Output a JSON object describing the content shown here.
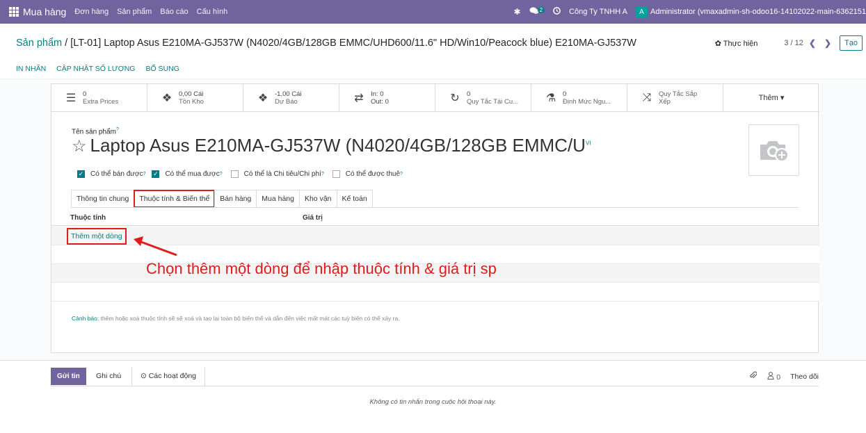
{
  "topbar": {
    "brand": "Mua hàng",
    "menu": [
      "Đơn hàng",
      "Sản phẩm",
      "Báo cáo",
      "Cấu hình"
    ],
    "messages_badge": "2",
    "company": "Công Ty TNHH A",
    "avatar_letter": "A",
    "user": "Administrator (vmaxadmin-sh-odoo16-14102022-main-6362151"
  },
  "breadcrumb": {
    "parent": "Sản phẩm",
    "separator": " / ",
    "current": "[LT-01] Laptop Asus E210MA-GJ537W (N4020/4GB/128GB EMMC/UHD600/11.6\" HD/Win10/Peacock blue) E210MA-GJ537W"
  },
  "pager": {
    "action_label": "✿ Thực hiện",
    "counter": "3 / 12",
    "prev": "❮",
    "next": "❯",
    "create_label": "Tạo"
  },
  "actions": [
    "IN NHÃN",
    "CẬP NHẬT SỐ LƯỢNG",
    "BỔ SUNG"
  ],
  "smart_buttons": [
    {
      "icon": "☰",
      "value": "0",
      "label": "Extra Prices"
    },
    {
      "icon": "❖",
      "value": "0,00 Cái",
      "label": "Tồn Kho"
    },
    {
      "icon": "❖",
      "value": "-1,00 Cái",
      "label": "Dự Báo"
    },
    {
      "icon": "⇄",
      "value": "In:  0",
      "label": "Out:  0"
    },
    {
      "icon": "↻",
      "value": "0",
      "label": "Quy Tắc Tái Cu..."
    },
    {
      "icon": "⚗",
      "value": "0",
      "label": "Định Mức Ngu..."
    },
    {
      "icon": "⤨",
      "value": "Quy Tắc Sắp",
      "label": "Xếp"
    }
  ],
  "more_label": "Thêm ▾",
  "product": {
    "name_label": "Tên sản phẩm",
    "name_help": "?",
    "name": "Laptop Asus E210MA-GJ537W (N4020/4GB/128GB EMMC/U",
    "lang": "VI"
  },
  "checkboxes": [
    {
      "label": "Có thể bán được",
      "checked": true
    },
    {
      "label": "Có thể mua được",
      "checked": true
    },
    {
      "label": "Có thể là Chi tiêu/Chi phí",
      "checked": false
    },
    {
      "label": "Có thể được thuê",
      "checked": false
    }
  ],
  "tabs": [
    "Thông tin chung",
    "Thuộc tính & Biến thể",
    "Bán hàng",
    "Mua hàng",
    "Kho vận",
    "Kế toán"
  ],
  "active_tab": 1,
  "list": {
    "col_attribute": "Thuộc tính",
    "col_values": "Giá trị",
    "add_line": "Thêm một dòng"
  },
  "warning": {
    "prefix": "Cảnh báo:",
    "text": " thêm hoặc xoá thuộc tính sẽ sẽ xoá và tạo lại toàn bộ biến thể và dẫn đến việc mất mát các tuỳ biến có thể xảy ra."
  },
  "annotation": "Chọn thêm một dòng để nhập thuộc tính & giá trị sp",
  "chatter": {
    "send": "Gửi tin",
    "note": "Ghi chú",
    "activities": "⊙ Các hoạt động",
    "followers_count": "0",
    "follow": "Theo dõi",
    "empty": "Không có tin nhắn trong cuộc hội thoại này."
  },
  "colors": {
    "brand": "#71639e",
    "accent": "#017e84",
    "highlight": "#e01b1b"
  }
}
